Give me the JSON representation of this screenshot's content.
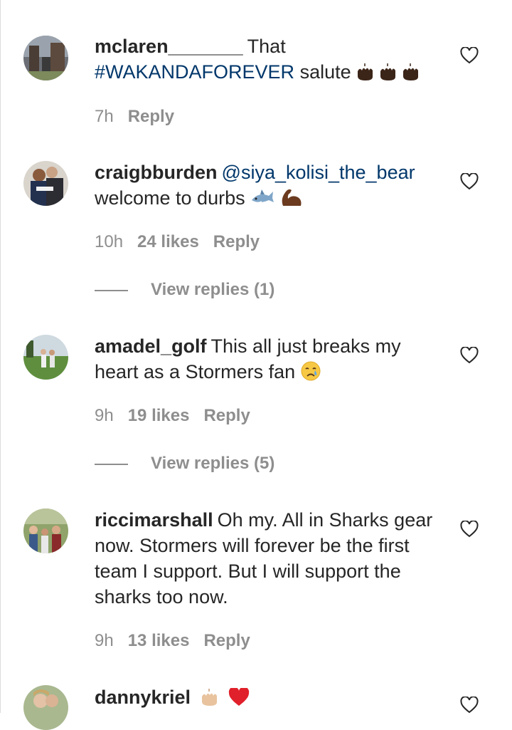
{
  "colors": {
    "username": "#262626",
    "link": "#00376b",
    "meta": "#8e8e8e"
  },
  "comments": [
    {
      "username": "mclaren_______",
      "text_before": "That ",
      "hashtag": "#WAKANDAFOREVER",
      "text_after": " salute",
      "emoji": [
        "raised-hands-dark",
        "raised-hands-dark",
        "raised-hands-dark"
      ],
      "time": "7h",
      "likes": "",
      "reply": "Reply"
    },
    {
      "username": "craigbburden",
      "mention": "@siya_kolisi_the_bear",
      "text_after": "welcome to durbs",
      "emoji": [
        "shark",
        "flexed-biceps-dark"
      ],
      "time": "10h",
      "likes": "24 likes",
      "reply": "Reply",
      "view_replies": "View replies (1)"
    },
    {
      "username": "amadel_golf",
      "text": "This all just breaks my heart as a Stormers fan",
      "emoji": [
        "crying-face"
      ],
      "time": "9h",
      "likes": "19 likes",
      "reply": "Reply",
      "view_replies": "View replies (5)"
    },
    {
      "username": "riccimarshall",
      "text": "Oh my. All in Sharks gear now. Stormers will forever be the first team I support. But I will support the sharks too now.",
      "time": "9h",
      "likes": "13 likes",
      "reply": "Reply"
    },
    {
      "username": "dannykriel",
      "text": "",
      "emoji": [
        "raised-hands-light",
        "red-heart"
      ]
    }
  ]
}
